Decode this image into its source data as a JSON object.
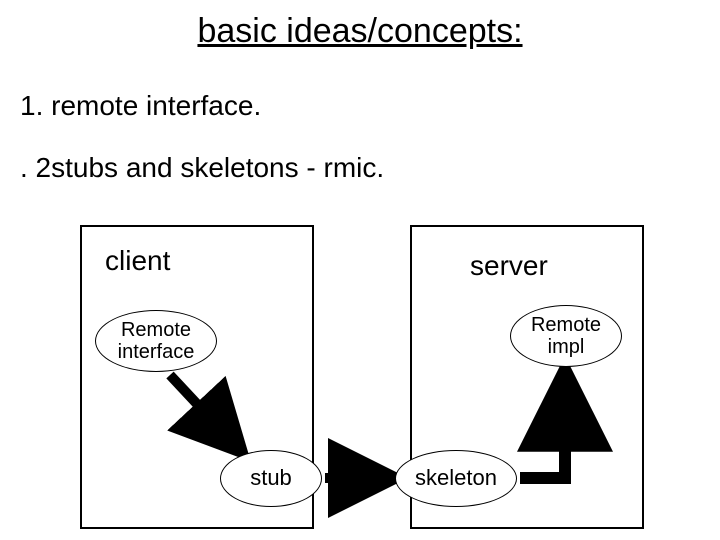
{
  "title": "basic ideas/concepts:",
  "bullets": {
    "b1": "1. remote interface.",
    "b2": ". 2stubs and skeletons - rmic."
  },
  "boxes": {
    "client": "client",
    "server": "server"
  },
  "nodes": {
    "remote_interface": "Remote interface",
    "remote_impl": "Remote impl",
    "stub": "stub",
    "skeleton": "skeleton"
  },
  "chart_data": {
    "type": "diagram",
    "title": "basic ideas/concepts:",
    "containers": [
      {
        "id": "client",
        "label": "client",
        "children": [
          "remote_interface",
          "stub"
        ]
      },
      {
        "id": "server",
        "label": "server",
        "children": [
          "remote_impl",
          "skeleton"
        ]
      }
    ],
    "nodes": [
      {
        "id": "remote_interface",
        "label": "Remote interface",
        "shape": "ellipse"
      },
      {
        "id": "remote_impl",
        "label": "Remote impl",
        "shape": "ellipse"
      },
      {
        "id": "stub",
        "label": "stub",
        "shape": "ellipse"
      },
      {
        "id": "skeleton",
        "label": "skeleton",
        "shape": "ellipse"
      }
    ],
    "edges": [
      {
        "from": "remote_interface",
        "to": "stub"
      },
      {
        "from": "stub",
        "to": "skeleton"
      },
      {
        "from": "skeleton",
        "to": "remote_impl"
      }
    ]
  }
}
